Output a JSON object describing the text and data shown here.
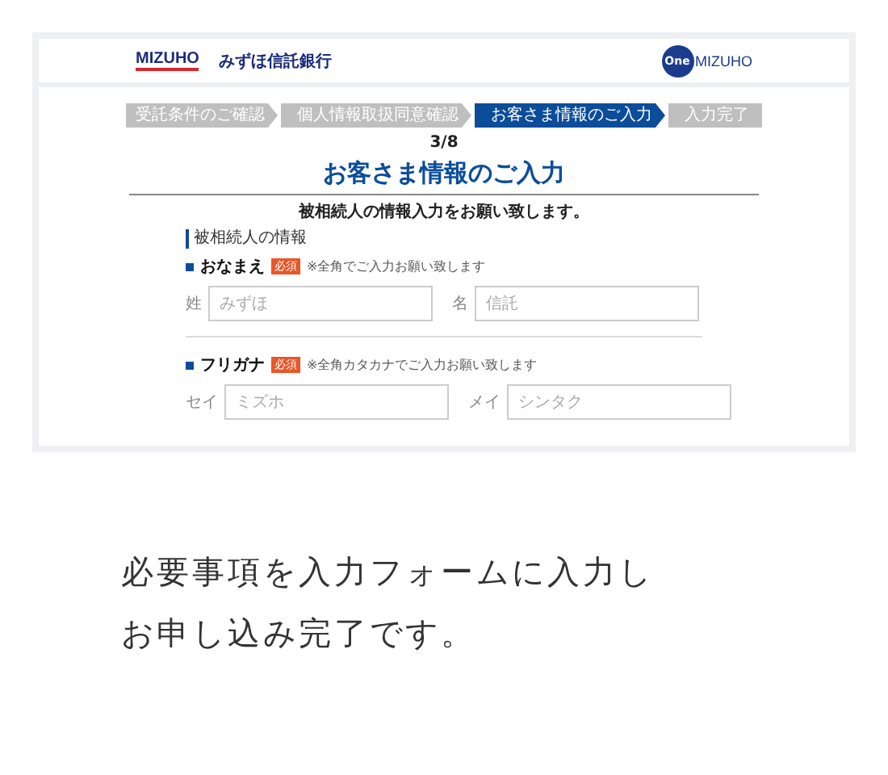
{
  "screenshot": {
    "header": {
      "logo": "MIZUHO",
      "bank_name": "みずほ信託銀行",
      "badge_logo": {
        "circle": "One",
        "word": "MIZUHO"
      }
    },
    "steps": [
      {
        "label": "受託条件のご確認",
        "selected": false
      },
      {
        "label": "個人情報取扱同意確認",
        "selected": false
      },
      {
        "label": "お客さま情報のご入力",
        "selected": true
      },
      {
        "label": "入力完了",
        "selected": false
      }
    ],
    "progress": "3/8",
    "title": "お客さま情報のご入力",
    "lead": "被相続人の情報入力をお願い致します。",
    "section": "被相続人の情報",
    "groups": [
      {
        "label": "おなまえ",
        "badge": "必須",
        "note": "※全角でご入力お願い致します",
        "fields": [
          {
            "label": "姓",
            "placeholder": "みずほ"
          },
          {
            "label": "名",
            "placeholder": "信託"
          }
        ]
      },
      {
        "label": "フリガナ",
        "badge": "必須",
        "note": "※全角カタカナでご入力お願い致します",
        "fields": [
          {
            "label": "セイ",
            "placeholder": "ミズホ"
          },
          {
            "label": "メイ",
            "placeholder": "シンタク"
          }
        ]
      }
    ]
  },
  "caption": [
    "必要事項を入力フォームに入力し",
    "お申し込み完了です。"
  ]
}
